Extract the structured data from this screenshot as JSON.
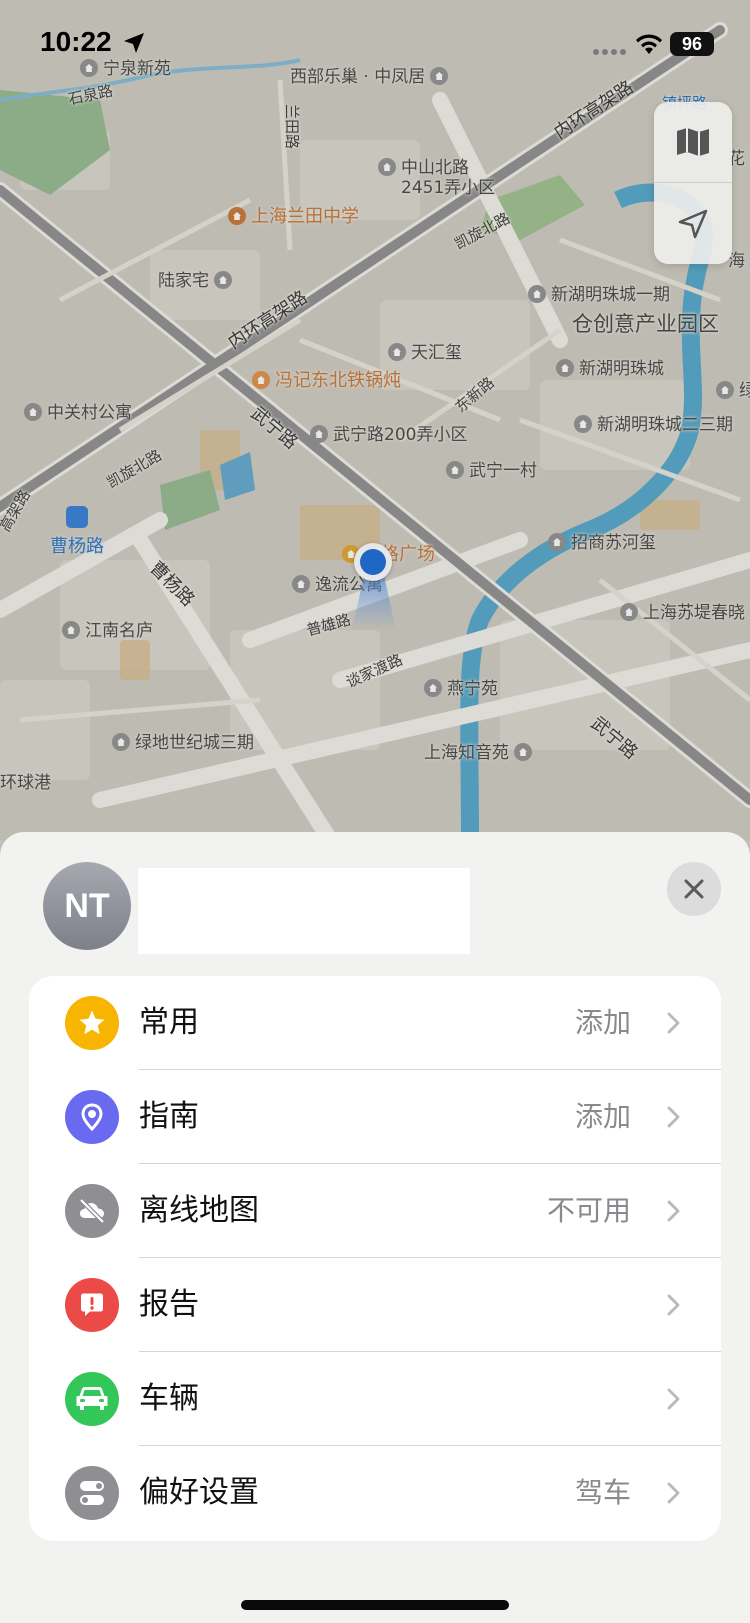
{
  "status_bar": {
    "time": "10:22",
    "battery": "96"
  },
  "map": {
    "labels": {
      "l1": "宁泉新苑",
      "l2": "西部乐巢 · 中凤居",
      "l3": "石泉路",
      "l4": "中山北路\n2451弄小区",
      "l5": "上海兰田中学",
      "l6": "陆家宅",
      "l7": "新湖明珠城一期",
      "l8": "仓创意产业园区",
      "l9": "天汇玺",
      "l10": "新湖明珠城",
      "l11": "冯记东北铁锅炖",
      "l12": "中关村公寓",
      "l13": "武宁路200弄小区",
      "l14": "新湖明珠城二三期",
      "l15": "武宁一村",
      "l16": "曹杨路",
      "l17": "招商苏河玺",
      "l18": "格广场",
      "l19": "逸流公寓",
      "l20": "上海苏堤春晓",
      "l21": "江南名庐",
      "l22": "燕宁苑",
      "l23": "绿地世纪城三期",
      "l24": "上海知音苑",
      "l25": "环球港",
      "l26": "镇坪路",
      "l27": "花",
      "l28": "海",
      "l29": "绿"
    },
    "roads": {
      "r1": "内环高架路",
      "r2": "内环高架路",
      "r3": "兰田路",
      "r4": "凯旋北路",
      "r5": "武宁路",
      "r6": "东新路",
      "r7": "凯旋北路",
      "r8": "曹杨路",
      "r9": "普雄路",
      "r10": "谈家渡路",
      "r11": "武宁路",
      "r12": "高架路"
    }
  },
  "profile": {
    "initials": "NT"
  },
  "menu": [
    {
      "label": "常用",
      "value": "添加",
      "icon": "star-icon",
      "color": "#f7b500"
    },
    {
      "label": "指南",
      "value": "添加",
      "icon": "guide-pin-icon",
      "color": "#6a6af0"
    },
    {
      "label": "离线地图",
      "value": "不可用",
      "icon": "cloud-off-icon",
      "color": "#8e8e93"
    },
    {
      "label": "报告",
      "value": "",
      "icon": "report-bubble-icon",
      "color": "#ec4a47"
    },
    {
      "label": "车辆",
      "value": "",
      "icon": "car-icon",
      "color": "#33c659"
    },
    {
      "label": "偏好设置",
      "value": "驾车",
      "icon": "toggles-icon",
      "color": "#8e8e93"
    }
  ]
}
